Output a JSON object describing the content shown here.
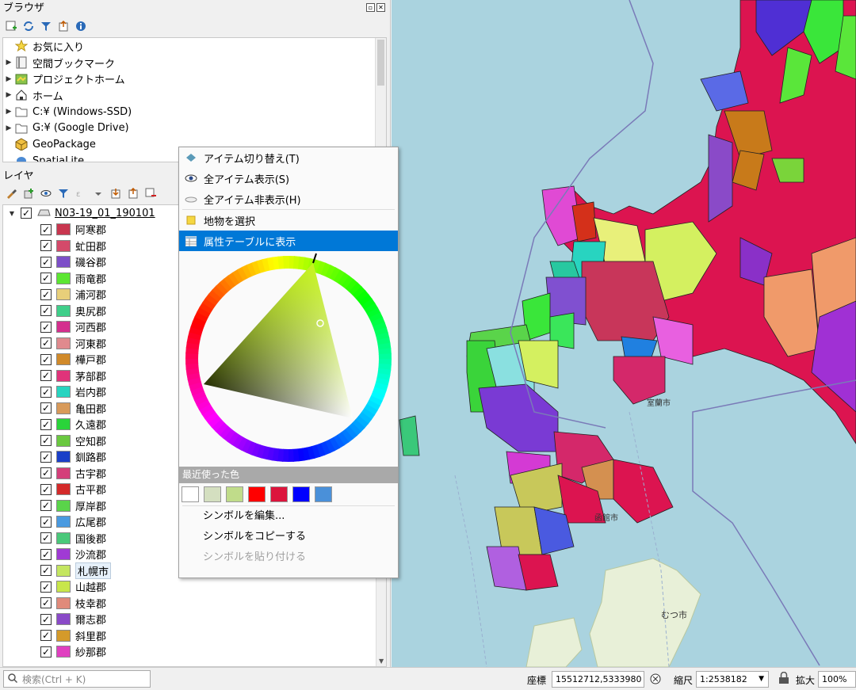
{
  "browser": {
    "title": "ブラウザ",
    "items": [
      {
        "label": "お気に入り",
        "icon": "star-icon"
      },
      {
        "label": "空間ブックマーク",
        "icon": "bookmark-icon"
      },
      {
        "label": "プロジェクトホーム",
        "icon": "project-home-icon"
      },
      {
        "label": "ホーム",
        "icon": "home-icon"
      },
      {
        "label": "C:¥ (Windows-SSD)",
        "icon": "folder-icon"
      },
      {
        "label": "G:¥ (Google Drive)",
        "icon": "folder-icon"
      },
      {
        "label": "GeoPackage",
        "icon": "geopackage-icon"
      },
      {
        "label": "SpatiaLite",
        "icon": "spatialite-icon"
      }
    ]
  },
  "layers": {
    "title": "レイヤ",
    "group": {
      "label": "N03-19_01_190101"
    },
    "items": [
      {
        "label": "阿寒郡",
        "color": "#c8364f"
      },
      {
        "label": "虻田郡",
        "color": "#d44a6a"
      },
      {
        "label": "磯谷郡",
        "color": "#7d4fc8"
      },
      {
        "label": "雨竜郡",
        "color": "#5ce632"
      },
      {
        "label": "浦河郡",
        "color": "#e8cf7a"
      },
      {
        "label": "奥尻郡",
        "color": "#3fcf8a"
      },
      {
        "label": "河西郡",
        "color": "#d42f8e"
      },
      {
        "label": "河東郡",
        "color": "#e08a8e"
      },
      {
        "label": "樺戸郡",
        "color": "#d18a2a"
      },
      {
        "label": "茅部郡",
        "color": "#e0337a"
      },
      {
        "label": "岩内郡",
        "color": "#28d4c0"
      },
      {
        "label": "亀田郡",
        "color": "#d89a5a"
      },
      {
        "label": "久遠郡",
        "color": "#2ad43a"
      },
      {
        "label": "空知郡",
        "color": "#6ac840"
      },
      {
        "label": "釧路郡",
        "color": "#1a3fc8"
      },
      {
        "label": "古宇郡",
        "color": "#d43f7a"
      },
      {
        "label": "古平郡",
        "color": "#d42a2a"
      },
      {
        "label": "厚岸郡",
        "color": "#5ad44a"
      },
      {
        "label": "広尾郡",
        "color": "#4a9ae0"
      },
      {
        "label": "国後郡",
        "color": "#4ac87a"
      },
      {
        "label": "沙流郡",
        "color": "#a03ad4"
      },
      {
        "label": "札幌市",
        "color": "#c4e660"
      },
      {
        "label": "山越郡",
        "color": "#c8e64a"
      },
      {
        "label": "枝幸郡",
        "color": "#e08a7a"
      },
      {
        "label": "爾志郡",
        "color": "#8a4ac8"
      },
      {
        "label": "斜里郡",
        "color": "#d49a2a"
      },
      {
        "label": "紗那郡",
        "color": "#e040c0"
      }
    ]
  },
  "context_menu": {
    "toggle_items": "アイテム切り替え(T)",
    "show_all": "全アイテム表示(S)",
    "hide_all": "全アイテム非表示(H)",
    "select_features": "地物を選択",
    "open_attr_table": "属性テーブルに表示",
    "recent_colors_label": "最近使った色",
    "recent_colors": [
      "#ffffff",
      "#d4dfc0",
      "#c0dc8a",
      "#ff0000",
      "#dc143c",
      "#0000ff",
      "#4a90d9"
    ],
    "edit_symbol": "シンボルを編集...",
    "copy_symbol": "シンボルをコピーする",
    "paste_symbol": "シンボルを貼り付ける"
  },
  "statusbar": {
    "search_placeholder": "検索(Ctrl + K)",
    "coord_label": "座標",
    "coord_value": "15512712,5333980",
    "scale_label": "縮尺",
    "scale_value": "1:2538182",
    "magnify_label": "拡大",
    "magnify_value": "100%"
  },
  "map_labels": {
    "muroran": "室蘭市",
    "mutsu": "むつ市",
    "hakodate": "函館市"
  }
}
